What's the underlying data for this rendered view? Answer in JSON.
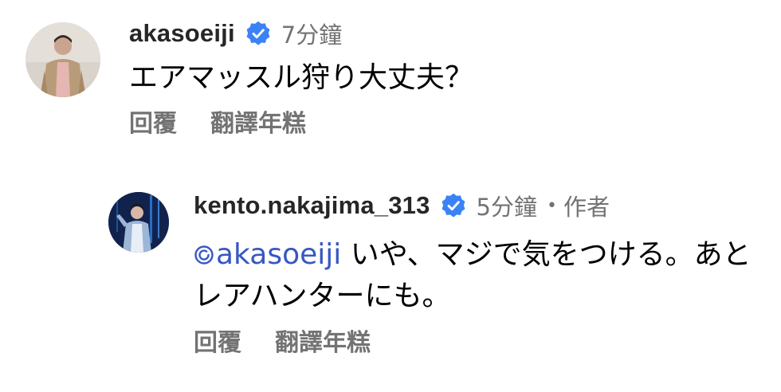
{
  "comments": [
    {
      "username": "akasoeiji",
      "verified": true,
      "time": "7分鐘",
      "text": "エアマッスル狩り大丈夫？",
      "reply_label": "回覆",
      "translate_label": "翻譯年糕"
    }
  ],
  "replies": [
    {
      "username": "kento.nakajima_313",
      "verified": true,
      "time": "5分鐘",
      "separator": "•",
      "author_tag": "作者",
      "mention": "akasoeiji",
      "text": " いや、マジで気をつける。あとレアハンターにも。",
      "reply_label": "回覆",
      "translate_label": "翻譯年糕"
    }
  ],
  "colors": {
    "verified_badge": "#3b82f6",
    "mention": "#3757c2",
    "secondary_text": "#737373",
    "username": "#262626"
  },
  "icons": {
    "verified": "verified-badge-icon",
    "mention": "mention-at-icon"
  }
}
